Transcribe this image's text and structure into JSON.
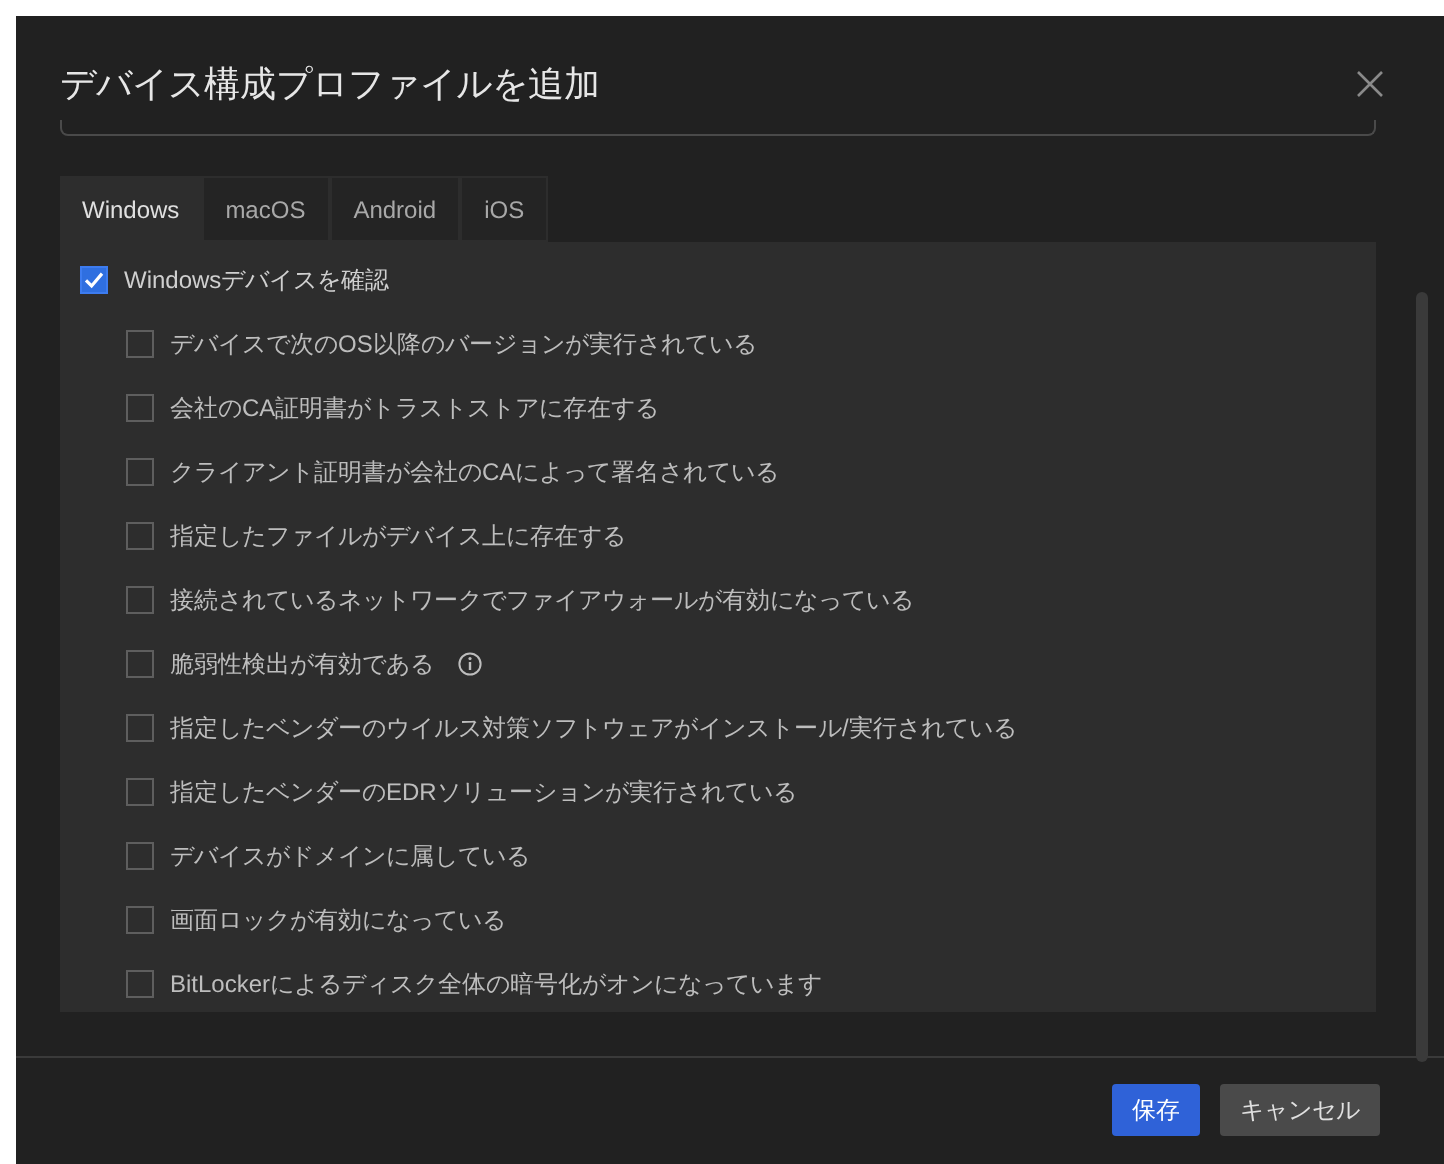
{
  "dialog": {
    "title": "デバイス構成プロファイルを追加"
  },
  "tabs": [
    {
      "label": "Windows",
      "selected": true
    },
    {
      "label": "macOS",
      "selected": false
    },
    {
      "label": "Android",
      "selected": false
    },
    {
      "label": "iOS",
      "selected": false
    }
  ],
  "main_check": {
    "label": "Windowsデバイスを確認",
    "checked": true
  },
  "conditions": [
    {
      "label": "デバイスで次のOS以降のバージョンが実行されている",
      "checked": false,
      "info": false
    },
    {
      "label": "会社のCA証明書がトラストストアに存在する",
      "checked": false,
      "info": false
    },
    {
      "label": "クライアント証明書が会社のCAによって署名されている",
      "checked": false,
      "info": false
    },
    {
      "label": "指定したファイルがデバイス上に存在する",
      "checked": false,
      "info": false
    },
    {
      "label": "接続されているネットワークでファイアウォールが有効になっている",
      "checked": false,
      "info": false
    },
    {
      "label": "脆弱性検出が有効である",
      "checked": false,
      "info": true
    },
    {
      "label": "指定したベンダーのウイルス対策ソフトウェアがインストール/実行されている",
      "checked": false,
      "info": false
    },
    {
      "label": "指定したベンダーのEDRソリューションが実行されている",
      "checked": false,
      "info": false
    },
    {
      "label": "デバイスがドメインに属している",
      "checked": false,
      "info": false
    },
    {
      "label": "画面ロックが有効になっている",
      "checked": false,
      "info": false
    },
    {
      "label": "BitLockerによるディスク全体の暗号化がオンになっています",
      "checked": false,
      "info": false
    }
  ],
  "buttons": [
    {
      "label": "保存",
      "kind": "primary"
    },
    {
      "label": "キャンセル",
      "kind": "secondary"
    }
  ]
}
